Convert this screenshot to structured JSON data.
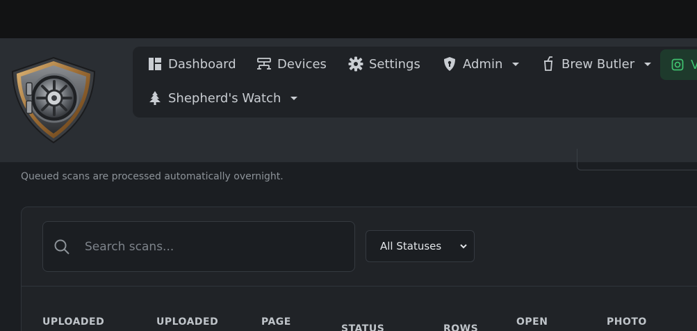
{
  "nav": {
    "items": [
      {
        "label": "Dashboard",
        "icon": "dashboard-icon"
      },
      {
        "label": "Devices",
        "icon": "devices-icon"
      },
      {
        "label": "Settings",
        "icon": "gear-icon"
      },
      {
        "label": "Admin",
        "icon": "shield-icon",
        "dropdown": true
      },
      {
        "label": "Brew Butler",
        "icon": "cup-icon",
        "dropdown": true
      },
      {
        "label": "Shepherd's Watch",
        "icon": "tree-icon",
        "dropdown": true
      }
    ],
    "chip": {
      "label": "V",
      "icon": "vault-icon",
      "accent": "#3fbf6e"
    }
  },
  "page": {
    "helper_text": "Queued scans are processed automatically overnight."
  },
  "filters": {
    "search_placeholder": "Search scans...",
    "status_selected": "All Statuses"
  },
  "table": {
    "columns": [
      "UPLOADED",
      "UPLOADED",
      "PAGE",
      "STATUS",
      "ROWS",
      "OPEN",
      "PHOTO"
    ]
  },
  "colors": {
    "background": "#1b1e22",
    "header": "#2a2e33",
    "nav": "#1f2226",
    "card": "#202327"
  }
}
